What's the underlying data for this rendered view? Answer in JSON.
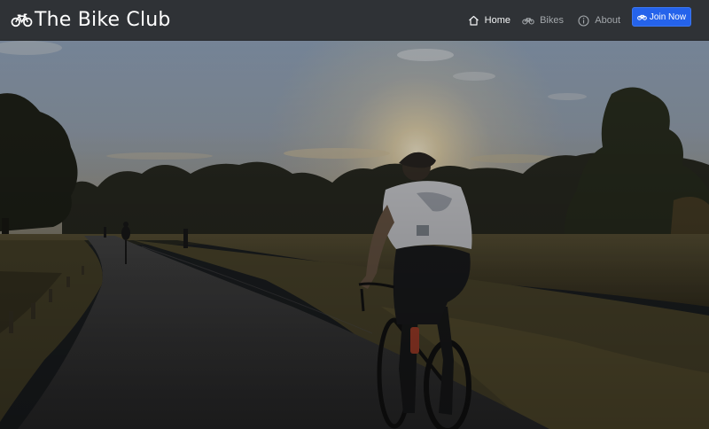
{
  "navbar": {
    "brand": "The Bike Club",
    "items": [
      {
        "label": "Home",
        "icon": "home-icon",
        "active": true
      },
      {
        "label": "Bikes",
        "icon": "bike-icon",
        "active": false
      },
      {
        "label": "About",
        "icon": "info-icon",
        "active": false
      }
    ],
    "cta_label": "Join Now",
    "cta_icon": "bike-icon"
  },
  "colors": {
    "navbar_bg": "#2f3236",
    "cta_bg": "#2563eb",
    "text_active": "#f3f4f5",
    "text_muted": "#a3a7ab"
  },
  "hero": {
    "image": "cyclist-at-sunset-photo"
  }
}
